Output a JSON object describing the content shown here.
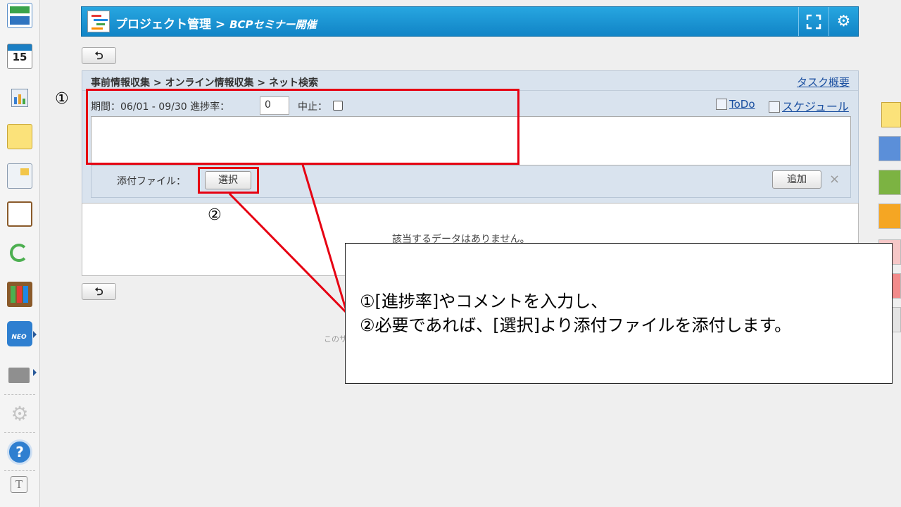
{
  "header": {
    "app": "プロジェクト管理",
    "separator": " > ",
    "project": "BCPセミナー開催"
  },
  "task": {
    "breadcrumb": "事前情報収集 > オンライン情報収集 > ネット検索",
    "overview_link": "タスク概要",
    "period_text": "期間：06/01 - 09/30  進捗率：",
    "progress_value": "0",
    "stop_label": "中止：",
    "todo_link": "ToDo",
    "schedule_link": "スケジュール",
    "comment_value": "",
    "attach_label": "添付ファイル：",
    "select_button": "選択",
    "add_button": "追加",
    "remove_icon": "×"
  },
  "empty_message": "該当するデータはありません。",
  "footer_partial": "このサ",
  "annotations": {
    "marker1": "①",
    "marker2": "②",
    "callout_line1": "①[進捗率]やコメントを入力し、",
    "callout_line2": "②必要であれば、[選択]より添付ファイルを添付します。"
  },
  "colors": {
    "header_blue": "#1a95d6",
    "highlight_red": "#e60012",
    "link_blue": "#1a4fa0"
  },
  "icons": {
    "back": "back-arrow-icon",
    "fullscreen": "expand-icon",
    "settings": "gear-icon"
  }
}
